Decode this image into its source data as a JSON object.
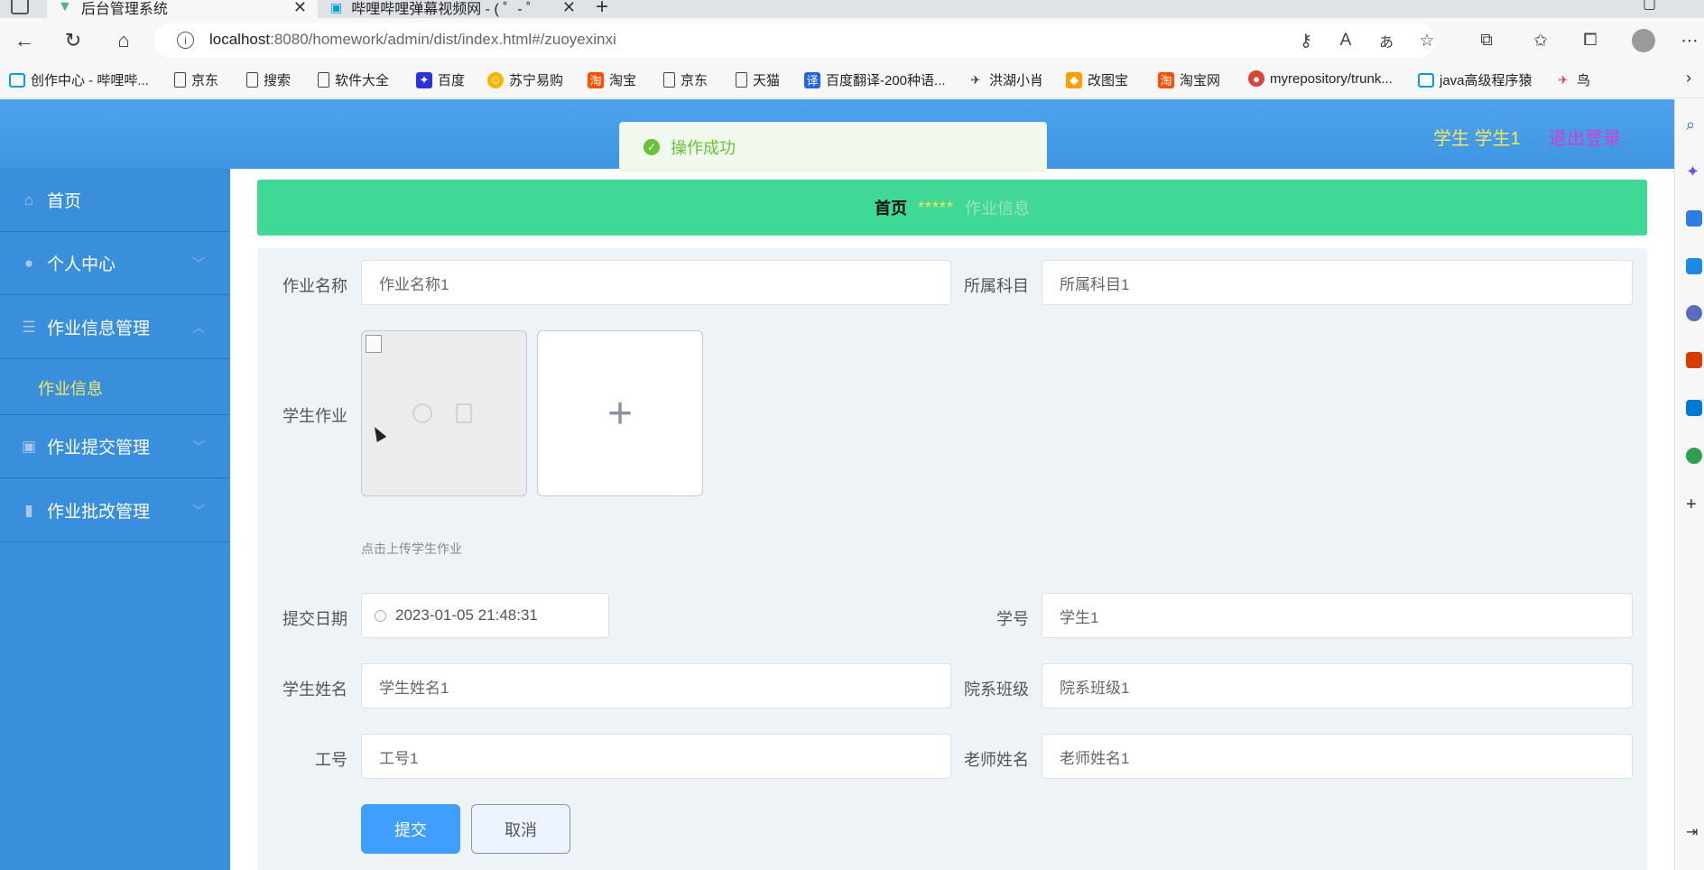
{
  "browser": {
    "tabs": [
      {
        "title": "后台管理系统"
      },
      {
        "title": "哔哩哔哩弹幕视频网 - ( ゜- ゜)つロ"
      }
    ],
    "address": {
      "host": "localhost",
      "rest": ":8080/homework/admin/dist/index.html#/zuoyexinxi"
    },
    "bookmarks": [
      {
        "label": "创作中心 - 哔哩哔...",
        "icon": "bilibili-icon"
      },
      {
        "label": "京东",
        "icon": "page-icon"
      },
      {
        "label": "搜索",
        "icon": "page-icon"
      },
      {
        "label": "软件大全",
        "icon": "page-icon"
      },
      {
        "label": "百度",
        "icon": "baidu-icon"
      },
      {
        "label": "苏宁易购",
        "icon": "suning-icon"
      },
      {
        "label": "淘宝",
        "icon": "taobao-icon"
      },
      {
        "label": "京东",
        "icon": "page-icon"
      },
      {
        "label": "天猫",
        "icon": "page-icon"
      },
      {
        "label": "百度翻译-200种语...",
        "icon": "translate-icon"
      },
      {
        "label": "洪湖小肖",
        "icon": "bird-icon"
      },
      {
        "label": "改图宝",
        "icon": "gaitubao-icon"
      },
      {
        "label": "淘宝网",
        "icon": "taobao-icon"
      },
      {
        "label": "myrepository/trunk...",
        "icon": "chrome-icon"
      },
      {
        "label": "java高级程序猿",
        "icon": "bilibili-icon"
      },
      {
        "label": "鸟",
        "icon": "bird-icon"
      }
    ]
  },
  "header": {
    "user": "学生 学生1",
    "logout": "退出登录"
  },
  "toast": {
    "message": "操作成功"
  },
  "sidebar": {
    "items": [
      {
        "label": "首页"
      },
      {
        "label": "个人中心"
      },
      {
        "label": "作业信息管理"
      },
      {
        "label": "作业提交管理"
      },
      {
        "label": "作业批改管理"
      }
    ],
    "sub_active": "作业信息"
  },
  "breadcrumb": {
    "home": "首页",
    "sep": "*****",
    "current": "作业信息"
  },
  "form": {
    "name_label": "作业名称",
    "name_value": "作业名称1",
    "subject_label": "所属科目",
    "subject_value": "所属科目1",
    "homework_label": "学生作业",
    "upload_tip": "点击上传学生作业",
    "date_label": "提交日期",
    "date_value": "2023-01-05 21:48:31",
    "stuno_label": "学号",
    "stuno_value": "学生1",
    "stuname_label": "学生姓名",
    "stuname_value": "学生姓名1",
    "class_label": "院系班级",
    "class_value": "院系班级1",
    "workno_label": "工号",
    "workno_value": "工号1",
    "teacher_label": "老师姓名",
    "teacher_value": "老师姓名1",
    "submit": "提交",
    "cancel": "取消"
  }
}
